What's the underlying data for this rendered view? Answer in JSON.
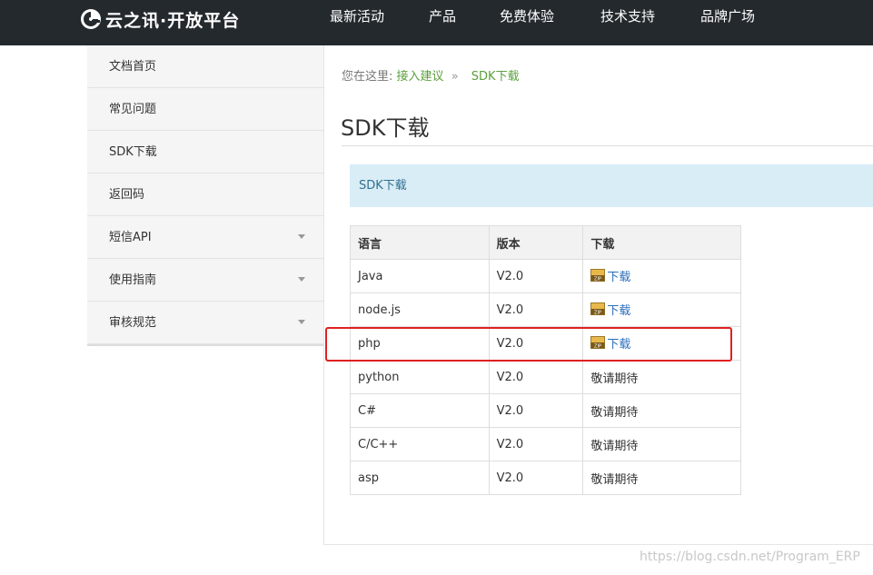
{
  "header": {
    "logo_text": "云之讯·开放平台",
    "nav": [
      "最新活动",
      "产品",
      "免费体验",
      "技术支持",
      "品牌广场"
    ]
  },
  "sidebar": {
    "items": [
      {
        "label": "文档首页",
        "has_caret": false
      },
      {
        "label": "常见问题",
        "has_caret": false
      },
      {
        "label": "SDK下载",
        "has_caret": false
      },
      {
        "label": "返回码",
        "has_caret": false
      },
      {
        "label": "短信API",
        "has_caret": true
      },
      {
        "label": "使用指南",
        "has_caret": true
      },
      {
        "label": "审核规范",
        "has_caret": true
      }
    ]
  },
  "breadcrumb": {
    "prefix": "您在这里:",
    "link": "接入建议",
    "separator": "»",
    "current": "SDK下载"
  },
  "page_title": "SDK下载",
  "info_bar": "SDK下载",
  "table": {
    "headers": [
      "语言",
      "版本",
      "下载"
    ],
    "rows": [
      {
        "lang": "Java",
        "version": "V2.0",
        "download": "下载",
        "has_link": true
      },
      {
        "lang": "node.js",
        "version": "V2.0",
        "download": "下载",
        "has_link": true
      },
      {
        "lang": "php",
        "version": "V2.0",
        "download": "下载",
        "has_link": true
      },
      {
        "lang": "python",
        "version": "V2.0",
        "download": "敬请期待",
        "has_link": false
      },
      {
        "lang": "C#",
        "version": "V2.0",
        "download": "敬请期待",
        "has_link": false
      },
      {
        "lang": "C/C++",
        "version": "V2.0",
        "download": "敬请期待",
        "has_link": false
      },
      {
        "lang": "asp",
        "version": "V2.0",
        "download": "敬请期待",
        "has_link": false
      }
    ]
  },
  "watermark": "https://blog.csdn.net/Program_ERP",
  "colors": {
    "topbar": "#24292e",
    "link_green": "#5aa03c",
    "link_blue": "#2a6ebb",
    "info_bg": "#d9edf7",
    "highlight": "#e02020"
  }
}
